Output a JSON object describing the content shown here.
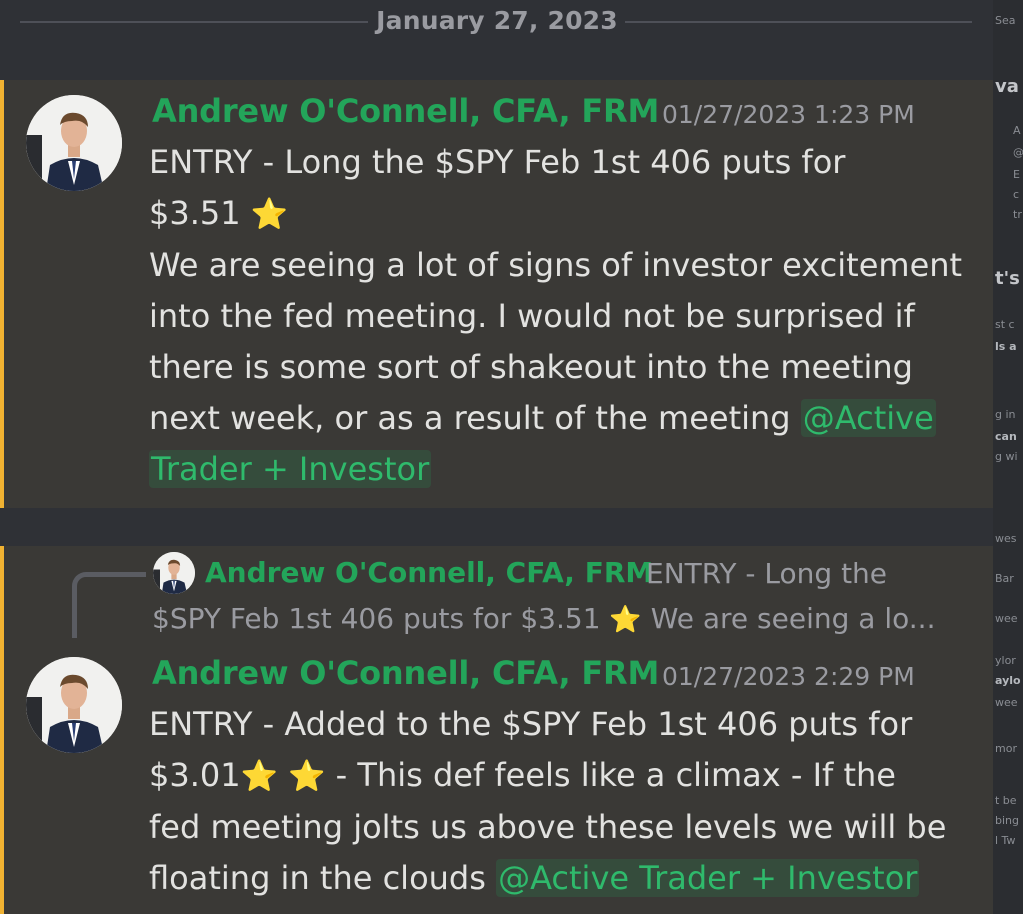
{
  "date_divider": "January 27, 2023",
  "messages": [
    {
      "author": "Andrew O'Connell, CFA, FRM",
      "timestamp": "01/27/2023 1:23 PM",
      "lines": [
        "ENTRY - Long the $SPY Feb 1st 406 puts for",
        "$3.51",
        "We are seeing a lot of signs of investor excitement",
        "into the fed meeting. I would not be surprised if",
        "there is some sort of shakeout into the meeting",
        "next week, or as a result of the meeting"
      ],
      "mention_part1": "@Active",
      "mention_part2": "Trader + Investor"
    },
    {
      "reply": {
        "author": "Andrew O'Connell, CFA, FRM",
        "preview_line1": "ENTRY - Long the",
        "preview_line2_a": "$SPY Feb 1st 406 puts for $3.51",
        "preview_line2_b": "We are seeing a lo..."
      },
      "author": "Andrew O'Connell, CFA, FRM",
      "timestamp": "01/27/2023 2:29 PM",
      "lines": [
        "ENTRY - Added to the $SPY Feb 1st 406 puts for",
        "$3.01",
        "- This def feels like a climax - If the",
        "fed meeting jolts us above these levels we will be",
        "floating in the clouds"
      ],
      "mention": "@Active Trader + Investor"
    }
  ],
  "icons": {
    "star": "⭐"
  },
  "right_panel_fragments": [
    "Sea",
    "va",
    "A",
    "@",
    "E",
    "c",
    "tr",
    "t's",
    "st c",
    "ls a",
    "g in",
    "can",
    "g wi",
    "wes",
    "Bar",
    "wee",
    "ylor",
    "aylo",
    "wee",
    "mor",
    "t be",
    "bing",
    "l Tw"
  ],
  "colors": {
    "author": "#23a55a",
    "accent_border": "#f0b232",
    "message_bg": "#3a3936"
  }
}
